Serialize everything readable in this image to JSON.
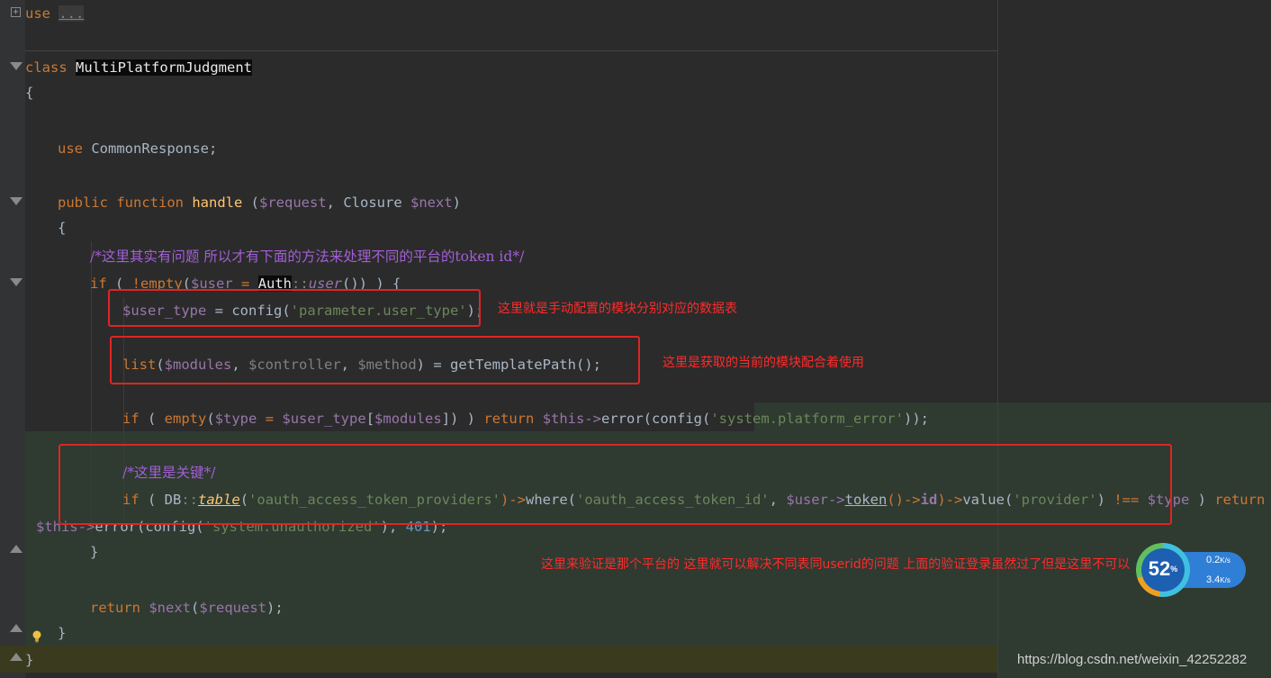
{
  "editor": {
    "lines": {
      "l1_kw": "use",
      "l1_dots": "...",
      "l2_kw": "class",
      "l2_name": "MultiPlatformJudgment",
      "l3": "{",
      "l4_kw": "use",
      "l4_rest": " CommonResponse;",
      "l5_kw1": "public",
      "l5_kw2": "function",
      "l5_fn": "handle",
      "l5_p1": " (",
      "l5_v1": "$request",
      "l5_p2": ", Closure ",
      "l5_v2": "$next",
      "l5_p3": ")",
      "l6": "{",
      "l7_comment": "/*这里其实有问题 所以才有下面的方法来处理不同的平台的token id*/",
      "l8_if": "if",
      "l8_p1": " ( ",
      "l8_empty": "!empty",
      "l8_p2": "(",
      "l8_user": "$user",
      "l8_eq": " = ",
      "l8_auth": "Auth",
      "l8_dc": "::",
      "l8_userfn": "user",
      "l8_p3": "()) ) {",
      "l9_var": "$user_type",
      "l9_eq": " = config(",
      "l9_str": "'parameter.user_type'",
      "l9_end": ");",
      "l10_list": "list",
      "l10_p1": "(",
      "l10_v1": "$modules",
      "l10_c1": ", ",
      "l10_v2": "$controller",
      "l10_c2": ", ",
      "l10_v3": "$method",
      "l10_end": ") = getTemplatePath();",
      "l11_if": "if",
      "l11_p1": " ( ",
      "l11_empty": "empty",
      "l11_p2": "(",
      "l11_type": "$type",
      "l11_eq": " = ",
      "l11_ut": "$user_type",
      "l11_br1": "[",
      "l11_mod": "$modules",
      "l11_br2": "]) ) ",
      "l11_ret": "return",
      "l11_this": " $this->",
      "l11_err": "error(config(",
      "l11_str": "'system.platform_error'",
      "l11_end": "));",
      "l12_comment": "/*这里是关键*/",
      "l13_if": "if",
      "l13_p1": " ( DB",
      "l13_dc": "::",
      "l13_table": "table",
      "l13_p2": "(",
      "l13_s1": "'oauth_access_token_providers'",
      "l13_arrow1": ")->",
      "l13_where": "where(",
      "l13_s2": "'oauth_access_token_id'",
      "l13_c": ", ",
      "l13_user": "$user->",
      "l13_token": "token",
      "l13_arrow2": "()->",
      "l13_id": "id",
      "l13_arrow3": ")->",
      "l13_value": "value(",
      "l13_s3": "'provider'",
      "l13_p3": ") ",
      "l13_neq": "!== ",
      "l13_type": "$type",
      "l13_p4": " ) ",
      "l13_ret": "return",
      "l14_this": "$this->",
      "l14_err": "error(config(",
      "l14_str": "'system.unauthorized'",
      "l14_c": "), ",
      "l14_num": "401",
      "l14_end": ");",
      "l15": "}",
      "l16_ret": "return",
      "l16_var": " $next",
      "l16_p1": "(",
      "l16_req": "$request",
      "l16_end": ");",
      "l17": "}",
      "l18": "}"
    }
  },
  "annotations": {
    "note1": "这里就是手动配置的模块分别对应的数据表",
    "note2": "这里是获取的当前的模块配合着使用",
    "note3": "这里来验证是那个平台的 这里就可以解决不同表同userid的问题 上面的验证登录虽然过了但是这里不可以"
  },
  "widget": {
    "percent": "52",
    "percent_sign": "%",
    "up_speed": "0.2",
    "up_unit": "K/s",
    "down_speed": "3.4",
    "down_unit": "K/s"
  },
  "watermark": "https://blog.csdn.net/weixin_42252282",
  "colors": {
    "background": "#2b2b2b",
    "keyword": "#cc7832",
    "variable": "#9876aa",
    "string": "#6a8759",
    "comment": "#a35fd6",
    "annotation": "#e02424"
  }
}
